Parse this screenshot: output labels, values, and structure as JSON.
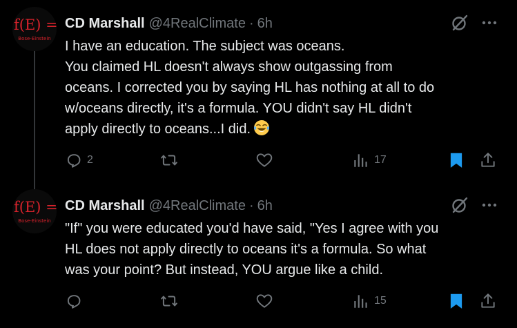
{
  "colors": {
    "background": "#000000",
    "text": "#e7e9ea",
    "muted": "#71767b",
    "bookmark_active": "#1d9bf0",
    "logo_red": "#d8222b"
  },
  "tweets": [
    {
      "avatar": {
        "logo_text": "f(E) =",
        "logo_sub": "Bose-Einstein"
      },
      "display_name": "CD Marshall",
      "handle": "@4RealClimate",
      "separator": "·",
      "time": "6h",
      "lines": [
        "I have an education. The subject was oceans.",
        "You claimed  HL doesn't always show outgassing from",
        "oceans. I corrected you by saying  HL has nothing at all to do",
        "w/oceans directly, it's a formula. YOU didn't say HL didn't",
        "apply directly to oceans...I did."
      ],
      "emoji": "face-with-tears-of-joy",
      "replies": "2",
      "retweets": "",
      "likes": "",
      "views": "17",
      "bookmarked": true
    },
    {
      "avatar": {
        "logo_text": "f(E) =",
        "logo_sub": "Bose-Einstein"
      },
      "display_name": "CD Marshall",
      "handle": "@4RealClimate",
      "separator": "·",
      "time": "6h",
      "lines": [
        "\"If\" you were educated you'd have said, \"Yes I agree with you",
        "HL does not apply directly to oceans it's a formula. So what",
        "was your point? But instead, YOU argue like a child."
      ],
      "replies": "",
      "retweets": "",
      "likes": "",
      "views": "15",
      "bookmarked": true
    }
  ],
  "icons": {
    "reply": "reply-icon",
    "retweet": "retweet-icon",
    "like": "heart-icon",
    "views": "views-icon",
    "bookmark": "bookmark-icon",
    "share": "share-icon",
    "grok": "grok-icon",
    "more": "more-icon"
  }
}
